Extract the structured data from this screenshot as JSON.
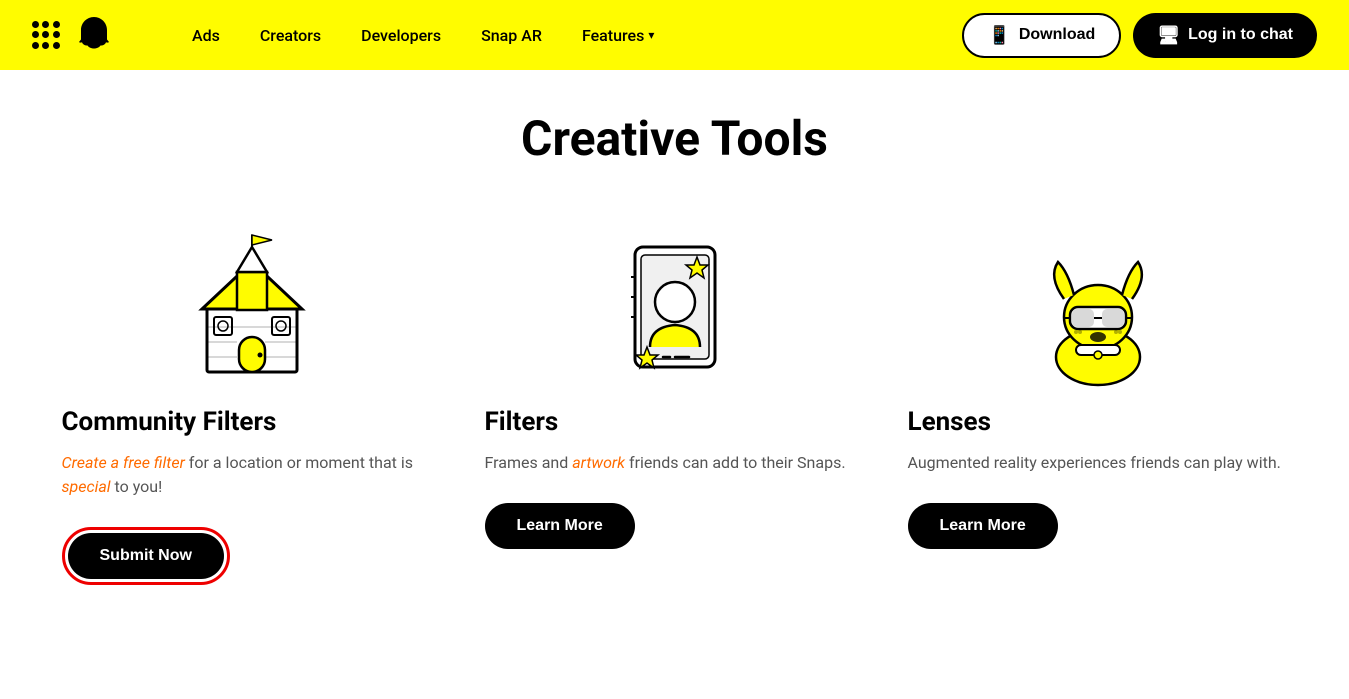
{
  "nav": {
    "links": [
      "Ads",
      "Creators",
      "Developers",
      "Snap AR",
      "Features"
    ],
    "download_label": "Download",
    "login_label": "Log in to chat"
  },
  "page": {
    "title": "Creative Tools"
  },
  "cards": [
    {
      "id": "community-filters",
      "title": "Community Filters",
      "desc_normal": "",
      "desc": "Create a free filter for a location or moment that is special to you!",
      "button_label": "Submit Now",
      "button_type": "submit"
    },
    {
      "id": "filters",
      "title": "Filters",
      "desc": "Frames and artwork friends can add to their Snaps.",
      "button_label": "Learn More",
      "button_type": "learn"
    },
    {
      "id": "lenses",
      "title": "Lenses",
      "desc": "Augmented reality experiences friends can play with.",
      "button_label": "Learn More",
      "button_type": "learn"
    }
  ]
}
